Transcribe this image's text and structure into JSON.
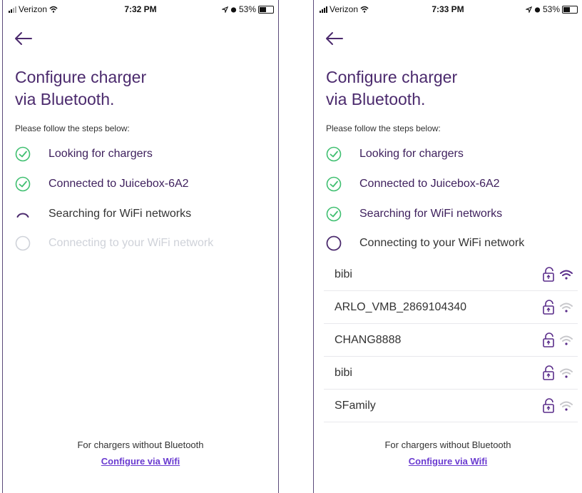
{
  "screens": [
    {
      "status": {
        "carrier": "Verizon",
        "time": "7:32 PM",
        "battery": "53%"
      },
      "title_line1": "Configure charger",
      "title_line2": "via Bluetooth.",
      "subtitle": "Please follow the steps below:",
      "steps": [
        {
          "label": "Looking for chargers",
          "state": "done"
        },
        {
          "label": "Connected to Juicebox-6A2",
          "state": "done"
        },
        {
          "label": "Searching for WiFi networks",
          "state": "in-progress"
        },
        {
          "label": "Connecting to your WiFi network",
          "state": "disabled"
        }
      ],
      "footer_text": "For chargers without Bluetooth",
      "footer_link": "Configure via Wifi"
    },
    {
      "status": {
        "carrier": "Verizon",
        "time": "7:33 PM",
        "battery": "53%"
      },
      "title_line1": "Configure charger",
      "title_line2": "via Bluetooth.",
      "subtitle": "Please follow the steps below:",
      "steps": [
        {
          "label": "Looking for chargers",
          "state": "done"
        },
        {
          "label": "Connected to Juicebox-6A2",
          "state": "done"
        },
        {
          "label": "Searching for WiFi networks",
          "state": "done"
        },
        {
          "label": "Connecting to your WiFi network",
          "state": "pending"
        }
      ],
      "networks": [
        {
          "name": "bibi",
          "signal": "strong"
        },
        {
          "name": "ARLO_VMB_2869104340",
          "signal": "weak"
        },
        {
          "name": "CHANG8888",
          "signal": "weak"
        },
        {
          "name": "bibi",
          "signal": "weak"
        },
        {
          "name": "SFamily",
          "signal": "weak"
        }
      ],
      "footer_text": "For chargers without Bluetooth",
      "footer_link": "Configure via Wifi"
    }
  ],
  "colors": {
    "accent": "#4b2a6d",
    "check_green": "#3fbf70",
    "link": "#6a3bd0",
    "disabled": "#cfd2d9"
  }
}
